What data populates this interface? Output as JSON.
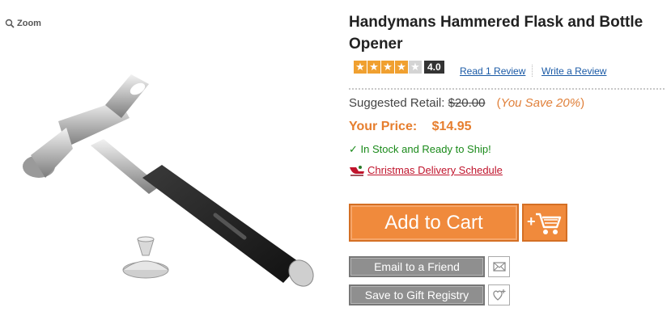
{
  "gallery": {
    "zoom_label": "Zoom"
  },
  "product": {
    "title": "Handymans Hammered Flask and Bottle Opener",
    "rating": {
      "value": 4,
      "max": 5,
      "label": "4.0"
    },
    "read_reviews_link": "Read 1 Review",
    "write_review_link": "Write a Review",
    "suggested_retail_label": "Suggested Retail:",
    "suggested_retail_price": "$20.00",
    "you_save_open": "(",
    "you_save_text": "You Save 20%",
    "you_save_close": ")",
    "your_price_label": "Your Price:",
    "your_price": "$14.95",
    "stock_check": "✓",
    "stock_status": "In Stock and Ready to Ship!",
    "christmas_link": "Christmas Delivery Schedule"
  },
  "actions": {
    "add_to_cart": "Add to Cart",
    "email_friend": "Email to a Friend",
    "gift_registry": "Save to Gift Registry"
  },
  "colors": {
    "accent_orange": "#f08a3c",
    "price_orange": "#e67e2e",
    "in_stock_green": "#1a8a1a",
    "link_blue": "#1a5aa6",
    "christmas_red": "#c0142c",
    "button_gray": "#8f8f8f"
  },
  "icons": {
    "zoom": "magnifier-icon",
    "cart": "shopping-cart-plus-icon",
    "email": "envelope-icon",
    "registry": "heart-plus-icon",
    "sleigh": "sleigh-icon"
  }
}
